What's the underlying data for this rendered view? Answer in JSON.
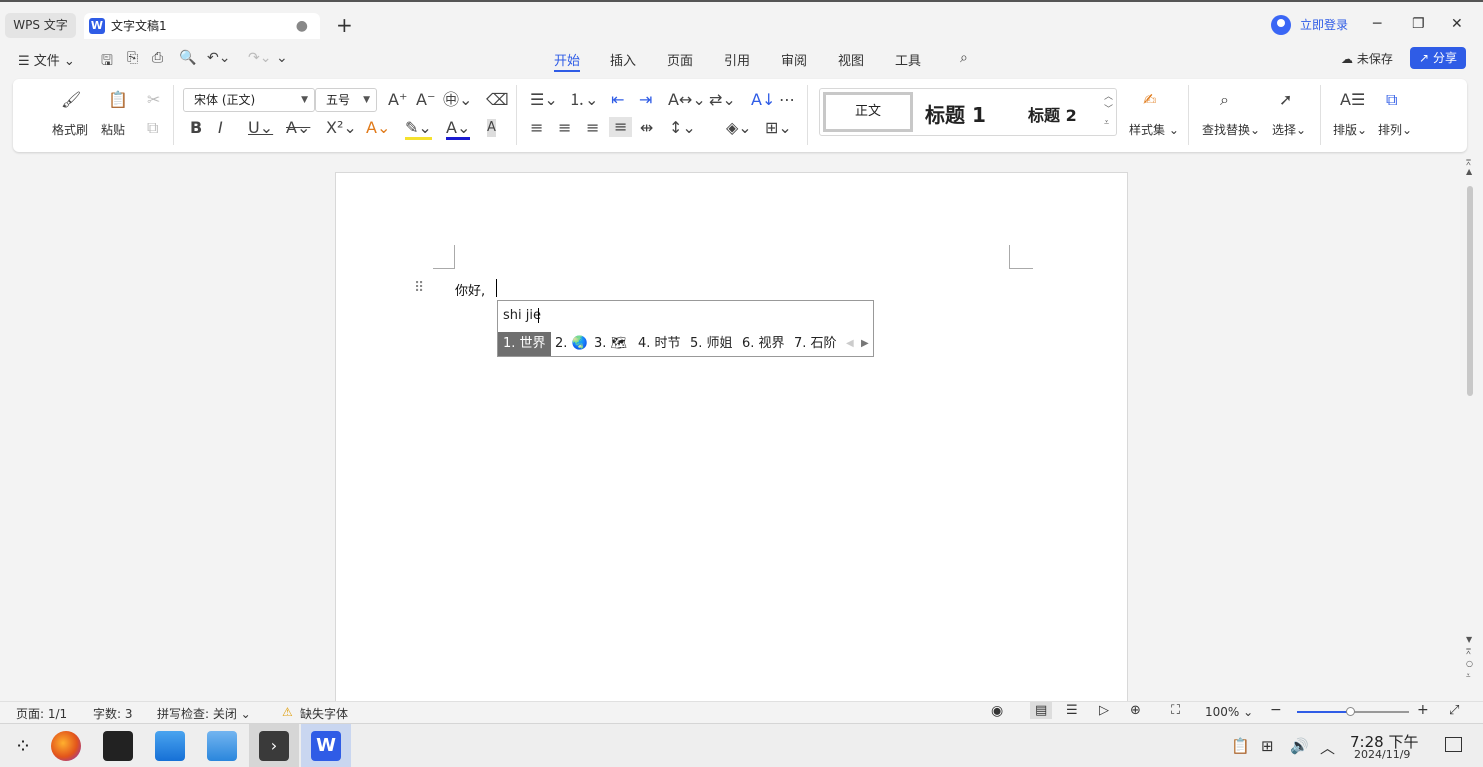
{
  "titlebar": {
    "home_tab": "WPS 文字",
    "doc_tab": "文字文稿1",
    "doc_tab_dot": "●",
    "new_tab": "+",
    "login": "立即登录",
    "minimize": "─",
    "restore": "❐",
    "close": "✕"
  },
  "menubar": {
    "file": "☰ 文件 ⌄",
    "tabs": [
      "开始",
      "插入",
      "页面",
      "引用",
      "审阅",
      "视图",
      "工具"
    ],
    "unsaved": "未保存",
    "share": "分享"
  },
  "ribbon": {
    "format_painter": "格式刷",
    "paste": "粘贴",
    "font_name": "宋体 (正文)",
    "font_size": "五号",
    "styles": {
      "normal": "正文",
      "h1": "标题 1",
      "h2": "标题 2"
    },
    "style_set": "样式集",
    "find_replace": "查找替换",
    "select": "选择",
    "layout": "排版",
    "arrange": "排列"
  },
  "document": {
    "text": "你好,"
  },
  "ime": {
    "input": "shi jie",
    "candidates": [
      "1. 世界",
      "2. 🌏",
      "3. 🗺",
      "4. 时节",
      "5. 师姐",
      "6. 视界",
      "7. 石阶"
    ]
  },
  "statusbar": {
    "page": "页面: 1/1",
    "word_count": "字数: 3",
    "spell_check": "拼写检查: 关闭",
    "missing_font": "缺失字体",
    "zoom": "100%",
    "zoom_level": 0.47
  },
  "taskbar": {
    "time": "7:28 下午",
    "date": "2024/11/9"
  },
  "colors": {
    "accent": "#2f5ce6",
    "ime_selected": "#6f6f6f"
  }
}
